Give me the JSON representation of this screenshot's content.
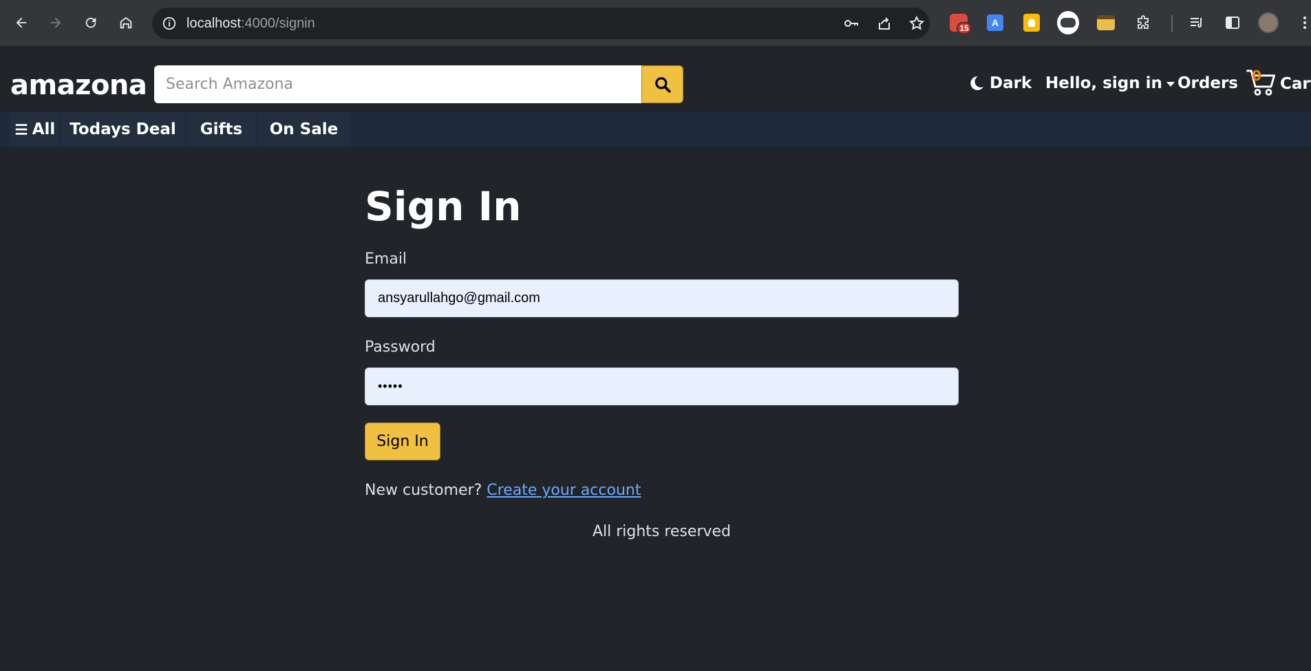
{
  "browser": {
    "url_host": "localhost",
    "url_path": ":4000/signin",
    "extension_badge": "15"
  },
  "header": {
    "brand": "amazona",
    "search_placeholder": "Search Amazona",
    "theme_label": "Dark",
    "account_label": "Hello, sign in",
    "orders_label": "Orders",
    "cart_count": "0",
    "cart_label": "Cart"
  },
  "subnav": {
    "all_label": "All",
    "items": [
      "Todays Deal",
      "Gifts",
      "On Sale"
    ]
  },
  "signin": {
    "title": "Sign In",
    "email_label": "Email",
    "email_value": "ansyarullahgo@gmail.com",
    "password_label": "Password",
    "password_value": "•••••",
    "button_label": "Sign In",
    "new_customer_text": "New customer?",
    "create_account_link": "Create your account"
  },
  "footer": {
    "text": "All rights reserved"
  },
  "colors": {
    "background": "#212529",
    "accent": "#f0c040",
    "subnav": "#232f3e",
    "link": "#6ea8fe",
    "input_bg": "#e8f0fe"
  }
}
